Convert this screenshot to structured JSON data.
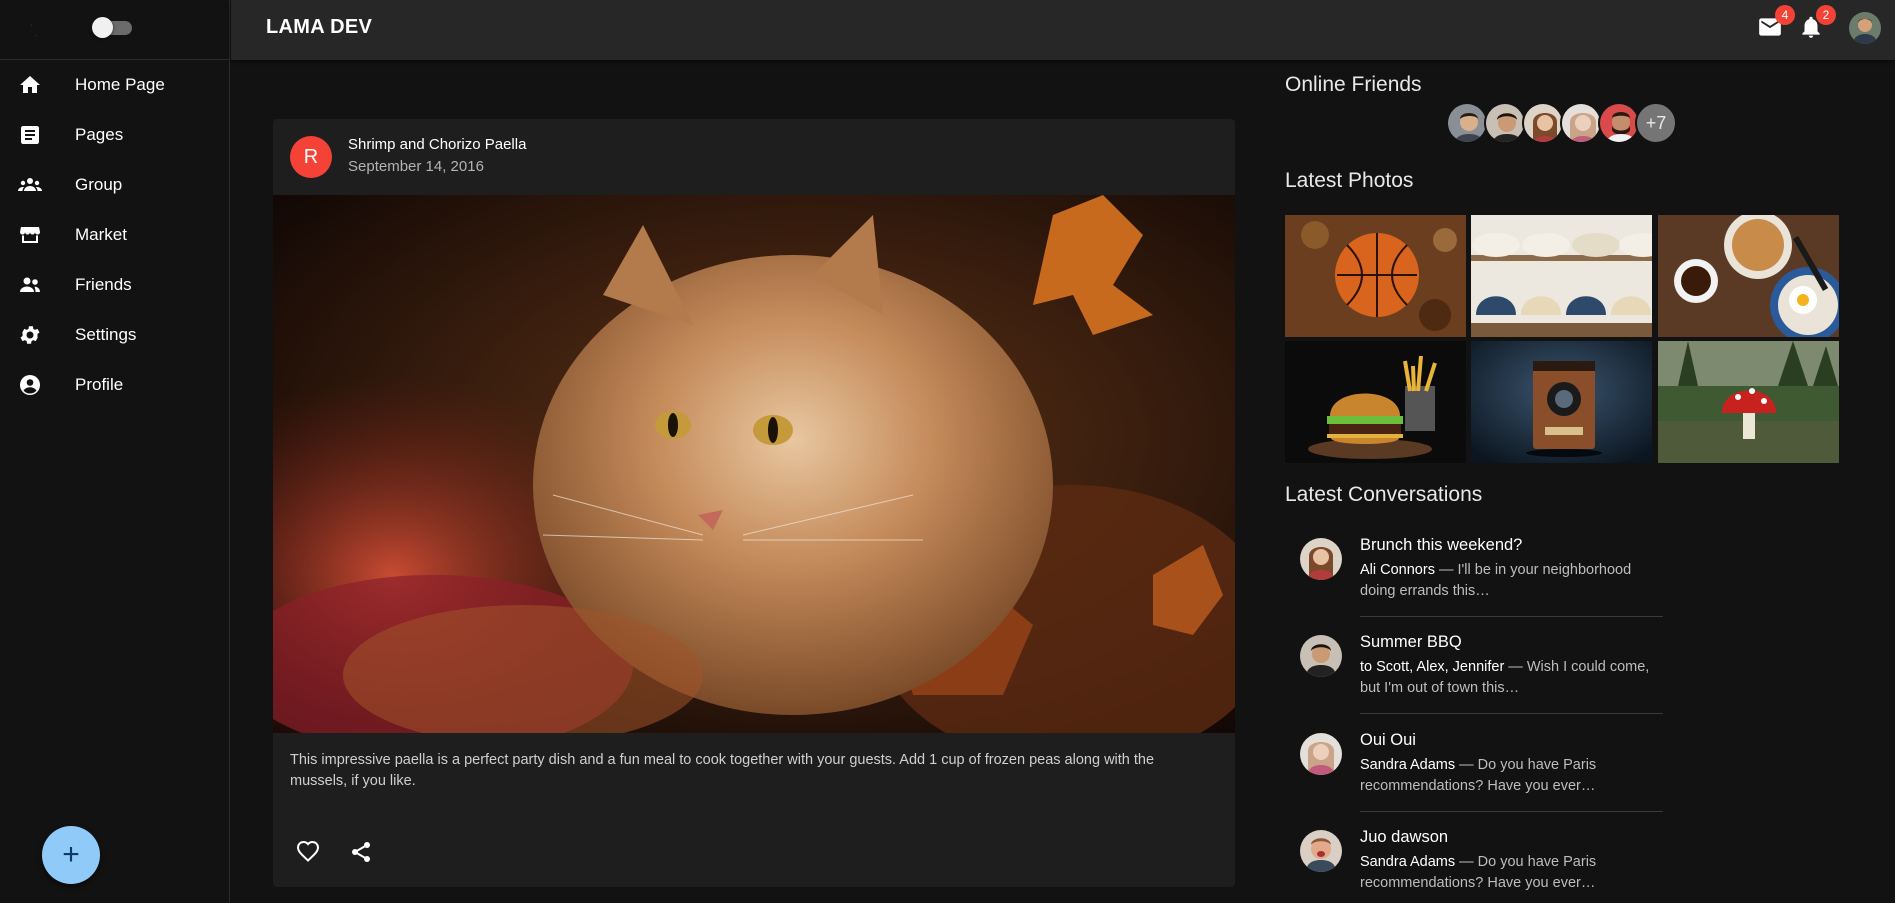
{
  "app": {
    "brand": "LAMA DEV"
  },
  "sidebar": {
    "items": [
      {
        "label": "Home Page",
        "icon": "home-icon"
      },
      {
        "label": "Pages",
        "icon": "article-icon"
      },
      {
        "label": "Group",
        "icon": "groups-icon"
      },
      {
        "label": "Market",
        "icon": "storefront-icon"
      },
      {
        "label": "Friends",
        "icon": "people-icon"
      },
      {
        "label": "Settings",
        "icon": "gear-icon"
      },
      {
        "label": "Profile",
        "icon": "account-circle-icon"
      }
    ],
    "fab_label": "+"
  },
  "topbar": {
    "mail_count": "4",
    "notification_count": "2"
  },
  "post": {
    "avatar_letter": "R",
    "title": "Shrimp and Chorizo Paella",
    "date": "September 14, 2016",
    "image": "cat-in-autumn-leaves",
    "text": "This impressive paella is a perfect party dish and a fun meal to cook together with your guests. Add 1 cup of frozen peas along with the mussels, if you like."
  },
  "right": {
    "online_title": "Online Friends",
    "online_more": "+7",
    "photos_title": "Latest Photos",
    "photos": [
      "basketball",
      "hats",
      "breakfast",
      "burger",
      "camera",
      "mushroom"
    ],
    "conversations_title": "Latest Conversations",
    "conversations": [
      {
        "title": "Brunch this weekend?",
        "who": "Ali Connors",
        "msg": " — I'll be in your neighborhood doing errands this…"
      },
      {
        "title": "Summer BBQ",
        "who": "to Scott, Alex, Jennifer",
        "msg": " — Wish I could come, but I'm out of town this…"
      },
      {
        "title": "Oui Oui",
        "who": "Sandra Adams",
        "msg": " — Do you have Paris recommendations? Have you ever…"
      },
      {
        "title": "Juo dawson",
        "who": "Sandra Adams",
        "msg": " — Do you have Paris recommendations? Have you ever…"
      }
    ]
  },
  "colors": {
    "accent": "#90caf9",
    "badge": "#f44336",
    "background": "#121212",
    "card": "#1e1e1e",
    "topbar": "#272727"
  }
}
